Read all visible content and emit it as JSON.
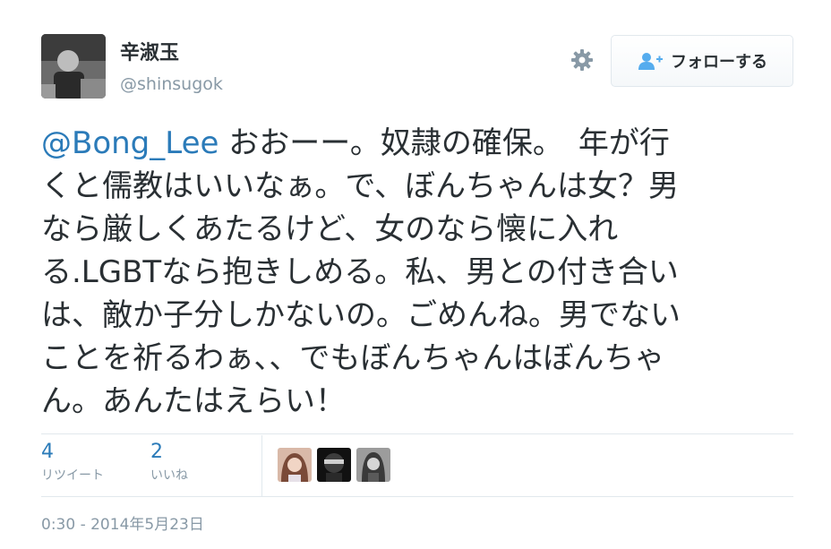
{
  "user": {
    "display_name": "辛淑玉",
    "screen_name": "@shinsugok"
  },
  "actions": {
    "settings_icon": "gear-icon",
    "follow_icon": "person-add-icon",
    "follow_label": "フォローする"
  },
  "tweet": {
    "mention": "@Bong_Lee",
    "lines": [
      " おおーー。奴隷の確保。　年が行",
      "くと儒教はいいなぁ。で、ぼんちゃんは女？男",
      "なら厳しくあたるけど、女のなら懐に入れ",
      "る.LGBTなら抱きしめる。私、男との付き合い",
      "は、敵か子分しかないの。ごめんね。男でない",
      "ことを祈るわぁ、、でもぼんちゃんはぼんちゃ",
      "ん。あんたはえらい！"
    ]
  },
  "stats": {
    "retweets": {
      "count": "4",
      "label": "リツイート"
    },
    "likes": {
      "count": "2",
      "label": "いいね"
    }
  },
  "timestamp": "0:30 - 2014年5月23日",
  "colors": {
    "link": "#2b7bb9",
    "secondary_text": "#8899a6",
    "primary_text": "#292f33",
    "border": "#e1e8ed"
  }
}
